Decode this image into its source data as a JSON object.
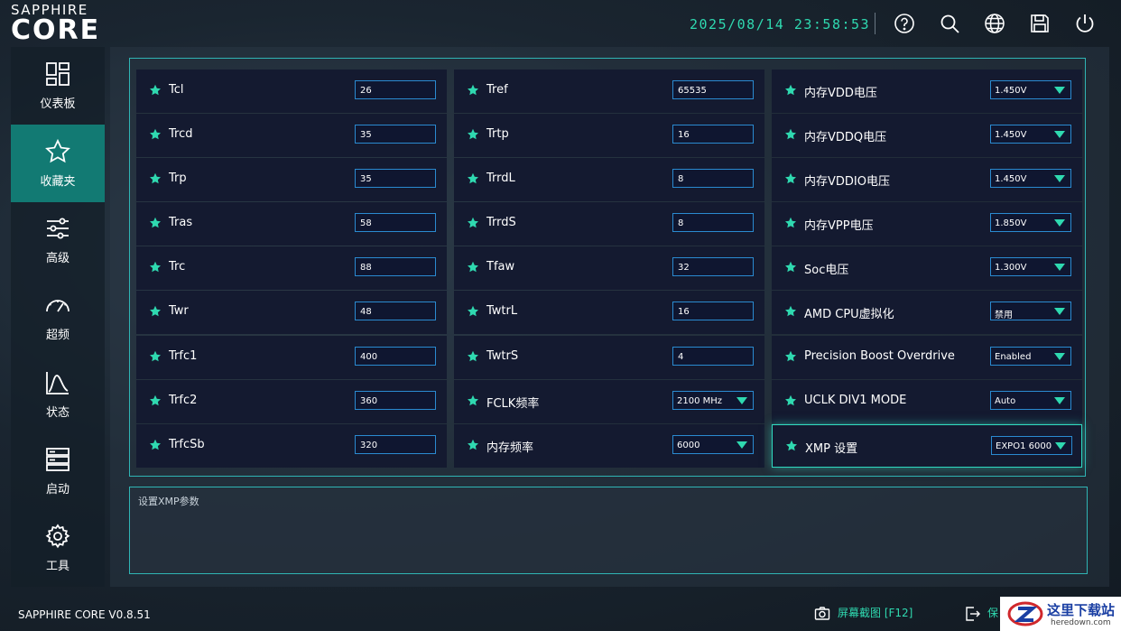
{
  "brand": {
    "small": "SAPPHIRE",
    "big": "CORE"
  },
  "header": {
    "datetime": "2025/08/14  23:58:53",
    "icons": [
      "help-icon",
      "search-icon",
      "globe-icon",
      "save-icon",
      "power-icon"
    ]
  },
  "sidebar": {
    "items": [
      {
        "label": "仪表板",
        "icon": "dashboard-icon"
      },
      {
        "label": "收藏夹",
        "icon": "star-icon",
        "active": true
      },
      {
        "label": "高级",
        "icon": "sliders-icon"
      },
      {
        "label": "超频",
        "icon": "gauge-icon"
      },
      {
        "label": "状态",
        "icon": "chart-icon"
      },
      {
        "label": "启动",
        "icon": "boot-icon"
      },
      {
        "label": "工具",
        "icon": "gear-icon"
      }
    ]
  },
  "columns": [
    [
      {
        "label": "Tcl",
        "value": "26"
      },
      {
        "label": "Trcd",
        "value": "35"
      },
      {
        "label": "Trp",
        "value": "35"
      },
      {
        "label": "Tras",
        "value": "58"
      },
      {
        "label": "Trc",
        "value": "88"
      },
      {
        "label": "Twr",
        "value": "48"
      },
      {
        "label": "Trfc1",
        "value": "400"
      },
      {
        "label": "Trfc2",
        "value": "360"
      },
      {
        "label": "TrfcSb",
        "value": "320"
      }
    ],
    [
      {
        "label": "Tref",
        "value": "65535"
      },
      {
        "label": "Trtp",
        "value": "16"
      },
      {
        "label": "TrrdL",
        "value": "8"
      },
      {
        "label": "TrrdS",
        "value": "8"
      },
      {
        "label": "Tfaw",
        "value": "32"
      },
      {
        "label": "TwtrL",
        "value": "16"
      },
      {
        "label": "TwtrS",
        "value": "4"
      },
      {
        "label": "FCLK频率",
        "value": "2100 MHz",
        "dropdown": true
      },
      {
        "label": "内存频率",
        "value": "6000",
        "dropdown": true
      }
    ],
    [
      {
        "label": "内存VDD电压",
        "value": "1.450V",
        "dropdown": true
      },
      {
        "label": "内存VDDQ电压",
        "value": "1.450V",
        "dropdown": true
      },
      {
        "label": "内存VDDIO电压",
        "value": "1.450V",
        "dropdown": true
      },
      {
        "label": "内存VPP电压",
        "value": "1.850V",
        "dropdown": true
      },
      {
        "label": "Soc电压",
        "value": "1.300V",
        "dropdown": true
      },
      {
        "label": "AMD CPU虚拟化",
        "value": "禁用",
        "dropdown": true
      },
      {
        "label": "Precision Boost Overdrive",
        "value": "Enabled",
        "dropdown": true
      },
      {
        "label": "UCLK DIV1 MODE",
        "value": "Auto",
        "dropdown": true
      },
      {
        "label": "XMP 设置",
        "value": "EXPO1 6000",
        "dropdown": true,
        "selected": true
      }
    ]
  ],
  "description": "设置XMP参数",
  "footer": {
    "version": "SAPPHIRE CORE V0.8.51",
    "screenshot": "屏幕截图 [F12]",
    "save_exit": "保"
  },
  "watermark": {
    "title": "这里下载站",
    "url": "heredown.com"
  },
  "colors": {
    "accent": "#2fd9b0",
    "active_nav": "#127a73",
    "cell_bg": "#141a30",
    "field_border": "#2a8ad0"
  }
}
